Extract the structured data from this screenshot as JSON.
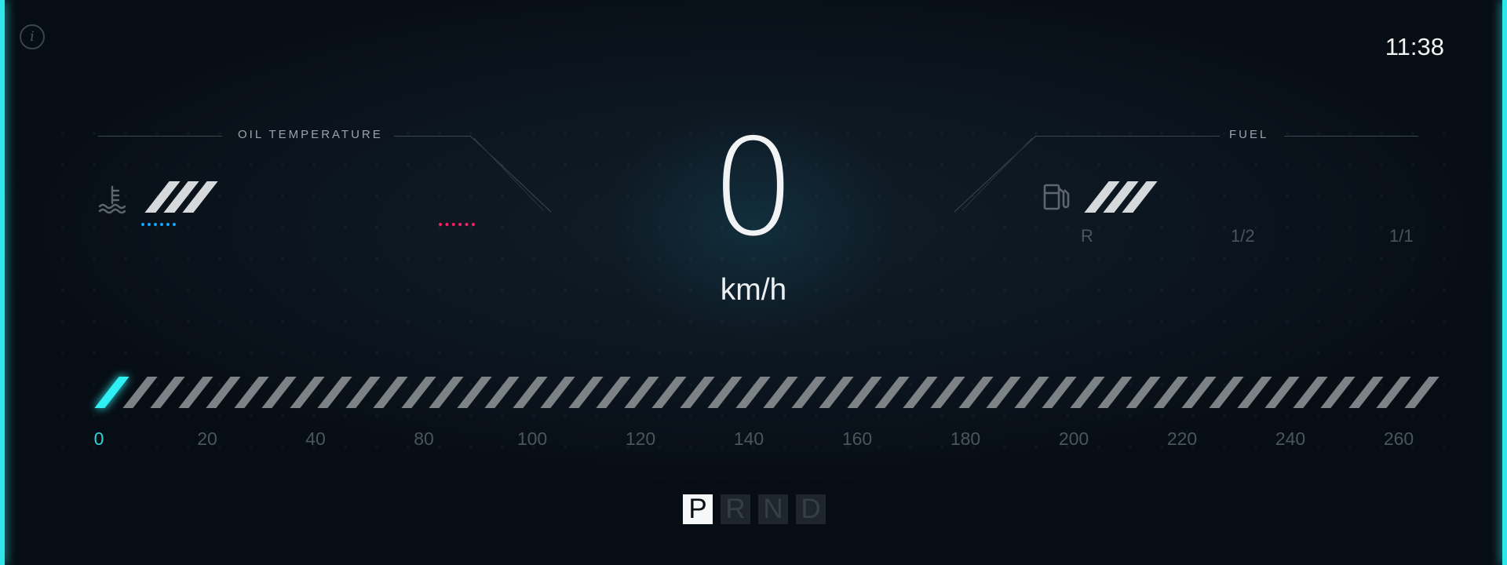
{
  "header": {
    "time": "11:38",
    "info_icon": "info-icon"
  },
  "oil_temperature": {
    "label": "OIL TEMPERATURE",
    "icon": "coolant-temperature-icon",
    "level_segments": 3,
    "cold_color": "#1aa3ff",
    "hot_color": "#ff1f5f"
  },
  "fuel": {
    "label": "FUEL",
    "icon": "fuel-pump-icon",
    "level_segments": 3,
    "marks": [
      "R",
      "1/2",
      "1/1"
    ]
  },
  "speed": {
    "value": "0",
    "unit": "km/h"
  },
  "speedometer": {
    "ticks": [
      "0",
      "20",
      "40",
      "80",
      "100",
      "120",
      "140",
      "160",
      "180",
      "200",
      "220",
      "240",
      "260"
    ],
    "active_tick_index": 0,
    "accent_color": "#2ff0f2"
  },
  "gears": {
    "items": [
      "P",
      "R",
      "N",
      "D"
    ],
    "selected": "P"
  }
}
